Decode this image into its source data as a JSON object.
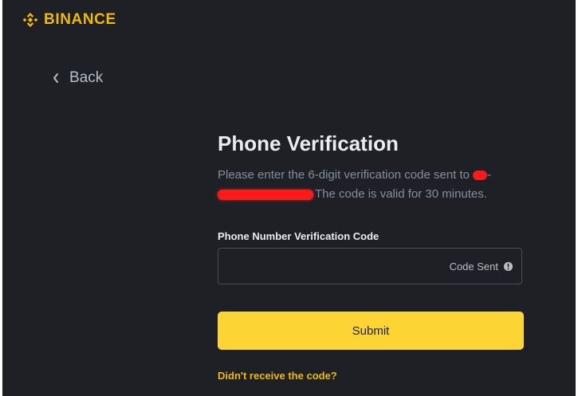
{
  "brand": {
    "name": "BINANCE",
    "icon": "binance-logo-icon",
    "color": "#f0b90b"
  },
  "nav": {
    "back_label": "Back",
    "back_icon": "chevron-left-icon"
  },
  "page": {
    "title": "Phone Verification",
    "description_prefix": "Please enter the 6-digit verification code sent to",
    "description_dash": "-",
    "description_suffix": "The code is valid for 30 minutes."
  },
  "form": {
    "code_field_label": "Phone Number Verification Code",
    "code_value": "",
    "code_status": "Code Sent",
    "code_status_icon": "info-icon",
    "submit_label": "Submit",
    "resend_link": "Didn't receive the code?"
  },
  "colors": {
    "background": "#1e2026",
    "accent": "#fcd535",
    "text_primary": "#eaecef",
    "text_secondary": "#848e9c"
  }
}
